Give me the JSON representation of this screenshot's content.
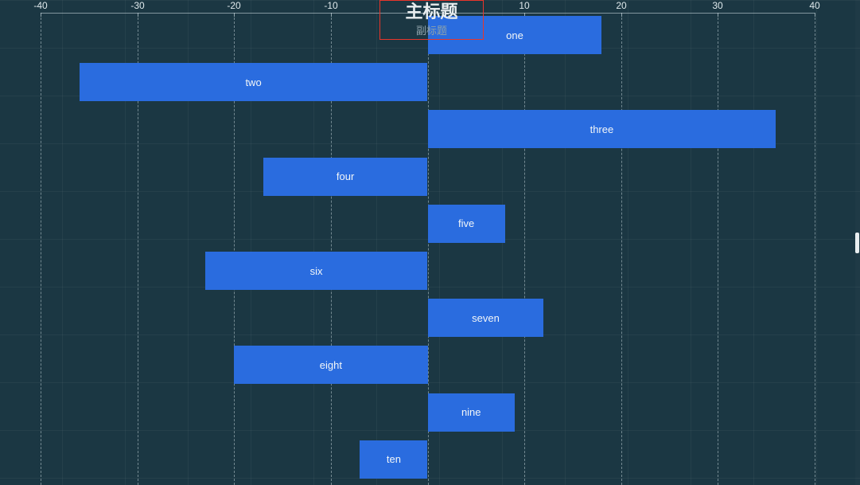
{
  "chart_data": {
    "type": "bar",
    "orientation": "horizontal",
    "title": "主标题",
    "subtitle": "副标题",
    "xlabel": "",
    "ylabel": "",
    "xlim": [
      -44,
      44.8
    ],
    "axis_position": "top",
    "grid": true,
    "legend": null,
    "tick_labels": [
      "-40",
      "-30",
      "-20",
      "-10",
      "10",
      "20",
      "30",
      "40"
    ],
    "tick_values": [
      -40,
      -30,
      -20,
      -10,
      10,
      20,
      30,
      40
    ],
    "categories": [
      "one",
      "two",
      "three",
      "four",
      "five",
      "six",
      "seven",
      "eight",
      "nine",
      "ten"
    ],
    "values": [
      18,
      -36,
      36,
      -17,
      8,
      -23,
      12,
      -20,
      9,
      -7
    ],
    "bar_color": "#2a6cdf",
    "background_color": "#1b3743"
  },
  "selection": {
    "highlight_color": "#e8362b"
  },
  "scrollbar": {
    "name": "vertical-scrollbar"
  }
}
